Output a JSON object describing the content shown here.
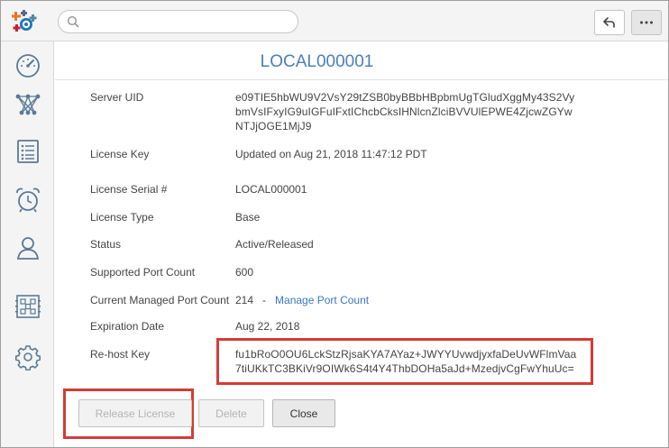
{
  "header": {
    "search_placeholder": "",
    "back_icon": "undo-arrow-icon",
    "more_icon": "ellipsis-icon"
  },
  "sidebar": {
    "items": [
      {
        "icon": "dashboard-gauge-icon"
      },
      {
        "icon": "topology-network-icon"
      },
      {
        "icon": "list-icon"
      },
      {
        "icon": "alarm-clock-icon"
      },
      {
        "icon": "user-icon"
      },
      {
        "icon": "device-grid-icon"
      },
      {
        "icon": "settings-gear-icon"
      }
    ]
  },
  "license": {
    "title": "LOCAL000001",
    "fields": {
      "server_uid": {
        "label": "Server UID",
        "value": "e09TIE5hbWU9V2VsY29tZSB0byBBbHBpbmUgTGludXggMy43S2VybmVsIFxyIG9uIGFuIFxtIChcbCksIHNlcnZlciBVVUlEPWE4ZjcwZGYwNTJjOGE1MjJ9"
      },
      "license_key": {
        "label": "License Key",
        "value": "Updated on Aug 21, 2018 11:47:12 PDT"
      },
      "serial": {
        "label": "License Serial #",
        "value": "LOCAL000001"
      },
      "type": {
        "label": "License Type",
        "value": "Base"
      },
      "status": {
        "label": "Status",
        "value": "Active/Released"
      },
      "supported_ports": {
        "label": "Supported Port Count",
        "value": "600"
      },
      "managed_ports": {
        "label": "Current Managed Port Count",
        "value": "214   -",
        "link": "Manage Port Count"
      },
      "expiration": {
        "label": "Expiration Date",
        "value": "Aug 22, 2018"
      },
      "rehost": {
        "label": "Re-host Key",
        "value": "fu1bRoO0OU6LckStzRjsaKYA7AYaz+JWYYUvwdjyxfaDeUvWFlmVaa7tiUKkTC3BKiVr9OIWk6S4t4Y4ThbDOHa5aJd+MzedjvCgFwYhuUc="
      }
    },
    "buttons": {
      "release": "Release License",
      "delete": "Delete",
      "close": "Close"
    }
  },
  "colors": {
    "accent": "#4a7fbd",
    "highlight": "#d43c35"
  }
}
